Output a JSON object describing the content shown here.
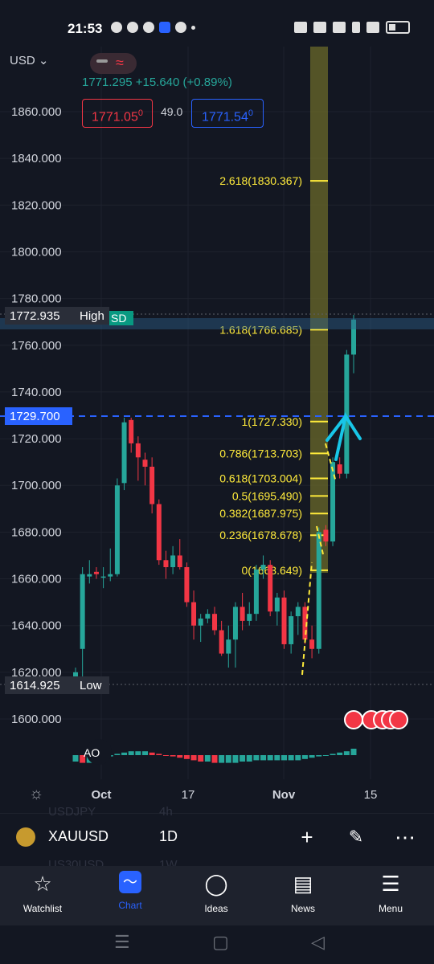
{
  "status_bar": {
    "time": "21:53"
  },
  "chart": {
    "currency_label": "USD",
    "quote_line": "1771.295  +15.640 (+0.89%)",
    "sell_price": "1771.05",
    "sell_price_sup": "0",
    "spread": "49.0",
    "buy_price": "1771.54",
    "buy_price_sup": "0",
    "price_axis_labels": [
      "1860.000",
      "1840.000",
      "1820.000",
      "1800.000",
      "1780.000",
      "1760.000",
      "1740.000",
      "1720.000",
      "1700.000",
      "1680.000",
      "1660.000",
      "1640.000",
      "1620.000",
      "1600.000"
    ],
    "time_axis_labels": [
      "Oct",
      "17",
      "Nov",
      "15"
    ],
    "high_label": "High",
    "high_value": "1772.935",
    "low_label": "Low",
    "low_value": "1614.925",
    "dashed_level_value": "1729.700",
    "partial_tag": "SD",
    "fib_levels": [
      {
        "label": "2.618(1830.367)",
        "price": 1830.367
      },
      {
        "label": "1.618(1766.685)",
        "price": 1766.685
      },
      {
        "label": "1(1727.330)",
        "price": 1727.33
      },
      {
        "label": "0.786(1713.703)",
        "price": 1713.703
      },
      {
        "label": "0.618(1703.004)",
        "price": 1703.004
      },
      {
        "label": "0.5(1695.490)",
        "price": 1695.49
      },
      {
        "label": "0.382(1687.975)",
        "price": 1687.975
      },
      {
        "label": "0.236(1678.678)",
        "price": 1678.678
      },
      {
        "label": "0(1663.649)",
        "price": 1663.649
      }
    ],
    "indicator_label": "AO",
    "colors": {
      "up": "#26a69a",
      "down": "#f23645",
      "fib": "#ffeb3b",
      "accent": "#2962ff",
      "background": "#131722"
    }
  },
  "chart_data": {
    "type": "candlestick",
    "symbol": "XAUUSD",
    "interval": "1D",
    "ylim": [
      1596,
      1876
    ],
    "candles": [
      {
        "o": 1618,
        "h": 1622,
        "l": 1614,
        "c": 1620
      },
      {
        "o": 1630,
        "h": 1665,
        "l": 1618,
        "c": 1662
      },
      {
        "o": 1661,
        "h": 1668,
        "l": 1658,
        "c": 1662
      },
      {
        "o": 1663,
        "h": 1665,
        "l": 1660,
        "c": 1662
      },
      {
        "o": 1661,
        "h": 1665,
        "l": 1656,
        "c": 1661
      },
      {
        "o": 1661,
        "h": 1673,
        "l": 1659,
        "c": 1662
      },
      {
        "o": 1662,
        "h": 1703,
        "l": 1661,
        "c": 1700
      },
      {
        "o": 1701,
        "h": 1729,
        "l": 1698,
        "c": 1727
      },
      {
        "o": 1728,
        "h": 1729,
        "l": 1714,
        "c": 1718
      },
      {
        "o": 1718,
        "h": 1721,
        "l": 1702,
        "c": 1712
      },
      {
        "o": 1711,
        "h": 1714,
        "l": 1700,
        "c": 1708
      },
      {
        "o": 1708,
        "h": 1712,
        "l": 1688,
        "c": 1692
      },
      {
        "o": 1692,
        "h": 1694,
        "l": 1666,
        "c": 1668
      },
      {
        "o": 1668,
        "h": 1672,
        "l": 1660,
        "c": 1665
      },
      {
        "o": 1665,
        "h": 1674,
        "l": 1662,
        "c": 1670
      },
      {
        "o": 1670,
        "h": 1677,
        "l": 1664,
        "c": 1665
      },
      {
        "o": 1665,
        "h": 1667,
        "l": 1648,
        "c": 1650
      },
      {
        "o": 1650,
        "h": 1655,
        "l": 1634,
        "c": 1640
      },
      {
        "o": 1640,
        "h": 1645,
        "l": 1633,
        "c": 1643
      },
      {
        "o": 1643,
        "h": 1647,
        "l": 1641,
        "c": 1645
      },
      {
        "o": 1645,
        "h": 1648,
        "l": 1636,
        "c": 1638
      },
      {
        "o": 1638,
        "h": 1642,
        "l": 1627,
        "c": 1628
      },
      {
        "o": 1628,
        "h": 1640,
        "l": 1622,
        "c": 1634
      },
      {
        "o": 1634,
        "h": 1650,
        "l": 1622,
        "c": 1648
      },
      {
        "o": 1648,
        "h": 1654,
        "l": 1638,
        "c": 1642
      },
      {
        "o": 1642,
        "h": 1650,
        "l": 1640,
        "c": 1645
      },
      {
        "o": 1645,
        "h": 1666,
        "l": 1642,
        "c": 1664
      },
      {
        "o": 1664,
        "h": 1670,
        "l": 1660,
        "c": 1666
      },
      {
        "o": 1666,
        "h": 1668,
        "l": 1644,
        "c": 1646
      },
      {
        "o": 1646,
        "h": 1654,
        "l": 1640,
        "c": 1652
      },
      {
        "o": 1652,
        "h": 1655,
        "l": 1630,
        "c": 1632
      },
      {
        "o": 1632,
        "h": 1646,
        "l": 1628,
        "c": 1644
      },
      {
        "o": 1644,
        "h": 1650,
        "l": 1636,
        "c": 1648
      },
      {
        "o": 1648,
        "h": 1650,
        "l": 1632,
        "c": 1634
      },
      {
        "o": 1634,
        "h": 1640,
        "l": 1626,
        "c": 1630
      },
      {
        "o": 1630,
        "h": 1682,
        "l": 1628,
        "c": 1680
      },
      {
        "o": 1681,
        "h": 1683,
        "l": 1674,
        "c": 1676
      },
      {
        "o": 1676,
        "h": 1712,
        "l": 1674,
        "c": 1710
      },
      {
        "o": 1709,
        "h": 1712,
        "l": 1703,
        "c": 1705
      },
      {
        "o": 1705,
        "h": 1758,
        "l": 1703,
        "c": 1756
      },
      {
        "o": 1756,
        "h": 1773,
        "l": 1748,
        "c": 1771
      }
    ],
    "ao_values": [
      -5,
      -6,
      -6,
      -4,
      -3,
      -1,
      1,
      2,
      3,
      3,
      3,
      2,
      1,
      0,
      -1,
      -2,
      -3,
      -4,
      -5,
      -5,
      -6,
      -6,
      -6,
      -6,
      -5,
      -5,
      -4,
      -4,
      -4,
      -4,
      -4,
      -4,
      -4,
      -3,
      -2,
      -1,
      0,
      1,
      2,
      3,
      5
    ]
  },
  "symbol_bar": {
    "symbol": "XAUUSD",
    "interval": "1D",
    "ghost_top_symbol": "USDJPY",
    "ghost_top_interval": "4h",
    "ghost_bottom_symbol": "US30USD",
    "ghost_bottom_interval": "1W"
  },
  "bottom_nav": [
    {
      "label": "Watchlist",
      "icon": "star-icon"
    },
    {
      "label": "Chart",
      "icon": "chart-icon"
    },
    {
      "label": "Ideas",
      "icon": "lightbulb-icon"
    },
    {
      "label": "News",
      "icon": "news-icon"
    },
    {
      "label": "Menu",
      "icon": "menu-icon"
    }
  ]
}
